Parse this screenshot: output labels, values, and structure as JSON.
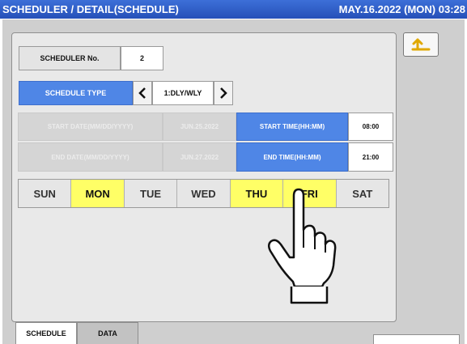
{
  "titlebar": {
    "title": "SCHEDULER / DETAIL(SCHEDULE)",
    "datetime": "MAY.16.2022 (MON) 03:28"
  },
  "back_button": {
    "icon": "return-arrow-icon",
    "color": "#e0a800"
  },
  "scheduler_no": {
    "label": "SCHEDULER No.",
    "value": "2"
  },
  "schedule_type": {
    "label": "SCHEDULE TYPE",
    "value": "1:DLY/WLY"
  },
  "start": {
    "date_label": "START DATE(MM/DD/YYYY)",
    "date_value": "JUN.25.2022",
    "time_label": "START TIME(HH:MM)",
    "time_value": "08:00"
  },
  "end": {
    "date_label": "END DATE(MM/DD/YYYY)",
    "date_value": "JUN.27.2022",
    "time_label": "END TIME(HH:MM)",
    "time_value": "21:00"
  },
  "days": [
    {
      "label": "SUN",
      "selected": false
    },
    {
      "label": "MON",
      "selected": true
    },
    {
      "label": "TUE",
      "selected": false
    },
    {
      "label": "WED",
      "selected": false
    },
    {
      "label": "THU",
      "selected": true
    },
    {
      "label": "FRI",
      "selected": true
    },
    {
      "label": "SAT",
      "selected": false
    }
  ],
  "tabs": [
    {
      "label": "SCHEDULE",
      "active": true
    },
    {
      "label": "DATA",
      "active": false
    }
  ],
  "colors": {
    "title_blue": "#2f5fcf",
    "accent_blue": "#4f86e6",
    "selected_yellow": "#ffff66"
  }
}
